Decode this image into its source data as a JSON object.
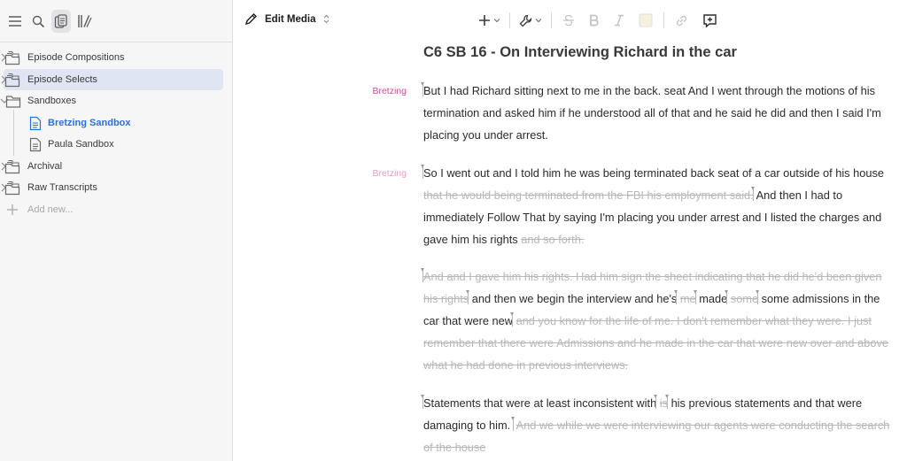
{
  "sidebar": {
    "items": [
      {
        "label": "Episode Compositions",
        "icon": "stack-folder-icon"
      },
      {
        "label": "Episode Selects",
        "icon": "stack-folder-icon"
      },
      {
        "label": "Sandboxes",
        "icon": "folder-icon"
      },
      {
        "label": "Bretzing Sandbox",
        "icon": "document-icon"
      },
      {
        "label": "Paula Sandbox",
        "icon": "document-icon"
      },
      {
        "label": "Archival",
        "icon": "stack-folder-icon"
      },
      {
        "label": "Raw Transcripts",
        "icon": "stack-folder-icon"
      }
    ],
    "add_new": "Add new..."
  },
  "toolbar": {
    "edit_media": "Edit Media"
  },
  "document": {
    "title": "C6 SB 16 - On Interviewing Richard in the car",
    "p1": {
      "speaker": "Bretzing",
      "text": "But I had Richard sitting next to me in the back. seat And I went through the motions of his termination and asked him if he understood all of that and he said he did and then I said I'm placing you under arrest."
    },
    "p2": {
      "speaker": "Bretzing",
      "a": "So I went out and I told him he was being terminated back seat of a car outside of his house",
      "b_del": "that he would being terminated from the FBI his employment said.",
      "c": "And then I had to immediately Follow That by saying I'm placing you under arrest and I listed the charges and gave him his rights",
      "d_del": "and so forth."
    },
    "p3": {
      "a_del": "And and I gave him his rights. Had him sign the sheet indicating that he did he'd been given his rights",
      "b": "and then we begin the interview and he's",
      "c_del": "me",
      "d": "made",
      "e_del": "some",
      "f": "some admissions in the car that were new",
      "g_del": "and you know for the life of me. I don't remember what they were. I just remember that there were Admissions and he made in the car that were new over and above what he had done in previous interviews."
    },
    "p4": {
      "a": "Statements that were at least inconsistent with",
      "b_del": "is",
      "c": "his previous statements and that were damaging to him.",
      "d_del": "And we while we were interviewing our agents were conducting the search of the house"
    }
  },
  "colors": {
    "speaker": "#d14b9c",
    "selection": "#dfe5f2",
    "link": "#2e6fd8",
    "deleted": "#b8b8bc"
  }
}
